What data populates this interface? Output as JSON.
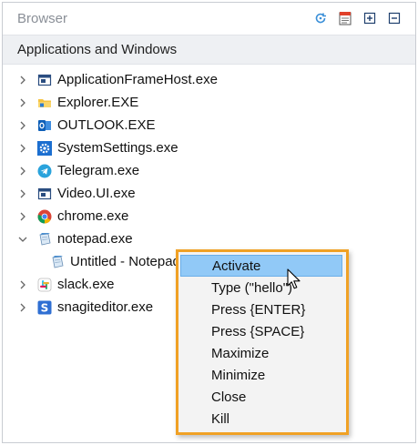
{
  "panel": {
    "title": "Browser",
    "toolbar": [
      {
        "name": "refresh-icon"
      },
      {
        "name": "properties-icon"
      },
      {
        "name": "expand-all-icon"
      },
      {
        "name": "collapse-all-icon"
      }
    ]
  },
  "section": {
    "title": "Applications and Windows"
  },
  "tree": {
    "items": [
      {
        "label": "ApplicationFrameHost.exe",
        "icon": "window-icon",
        "expanded": false
      },
      {
        "label": "Explorer.EXE",
        "icon": "folder-icon",
        "expanded": false
      },
      {
        "label": "OUTLOOK.EXE",
        "icon": "outlook-icon",
        "expanded": false
      },
      {
        "label": "SystemSettings.exe",
        "icon": "settings-gear-icon",
        "expanded": false
      },
      {
        "label": "Telegram.exe",
        "icon": "telegram-icon",
        "expanded": false
      },
      {
        "label": "Video.UI.exe",
        "icon": "window-icon",
        "expanded": false
      },
      {
        "label": "chrome.exe",
        "icon": "chrome-icon",
        "expanded": false
      },
      {
        "label": "notepad.exe",
        "icon": "notepad-icon",
        "expanded": true
      },
      {
        "label": "Untitled - Notepad",
        "icon": "notepad-icon",
        "child": true
      },
      {
        "label": "slack.exe",
        "icon": "slack-icon",
        "expanded": false
      },
      {
        "label": "snagiteditor.exe",
        "icon": "snagit-icon",
        "expanded": false
      }
    ]
  },
  "context_menu": {
    "items": [
      {
        "label": "Activate",
        "highlighted": true
      },
      {
        "label": "Type (\"hello\")"
      },
      {
        "label": "Press {ENTER}"
      },
      {
        "label": "Press {SPACE}"
      },
      {
        "label": "Maximize"
      },
      {
        "label": "Minimize"
      },
      {
        "label": "Close"
      },
      {
        "label": "Kill"
      }
    ]
  },
  "colors": {
    "menu_border": "#f0a125",
    "menu_highlight": "#91c9f7",
    "section_bg": "#eef0f3",
    "title_text": "#8a8f97"
  }
}
